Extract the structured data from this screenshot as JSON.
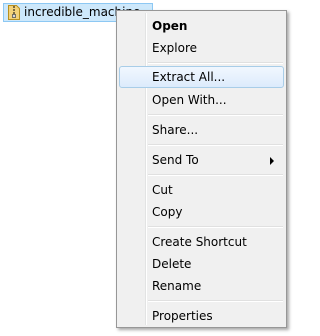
{
  "file": {
    "name": "incredible_machine",
    "icon": "zip-folder-icon"
  },
  "context_menu": {
    "items": [
      {
        "label": "Open"
      },
      {
        "label": "Explore"
      },
      {
        "label": "Extract All..."
      },
      {
        "label": "Open With..."
      },
      {
        "label": "Share..."
      },
      {
        "label": "Send To",
        "submenu_icon": "chevron-right-icon"
      },
      {
        "label": "Cut"
      },
      {
        "label": "Copy"
      },
      {
        "label": "Create Shortcut"
      },
      {
        "label": "Delete"
      },
      {
        "label": "Rename"
      },
      {
        "label": "Properties"
      }
    ],
    "default_item": "Open",
    "highlighted_item": "Extract All..."
  }
}
